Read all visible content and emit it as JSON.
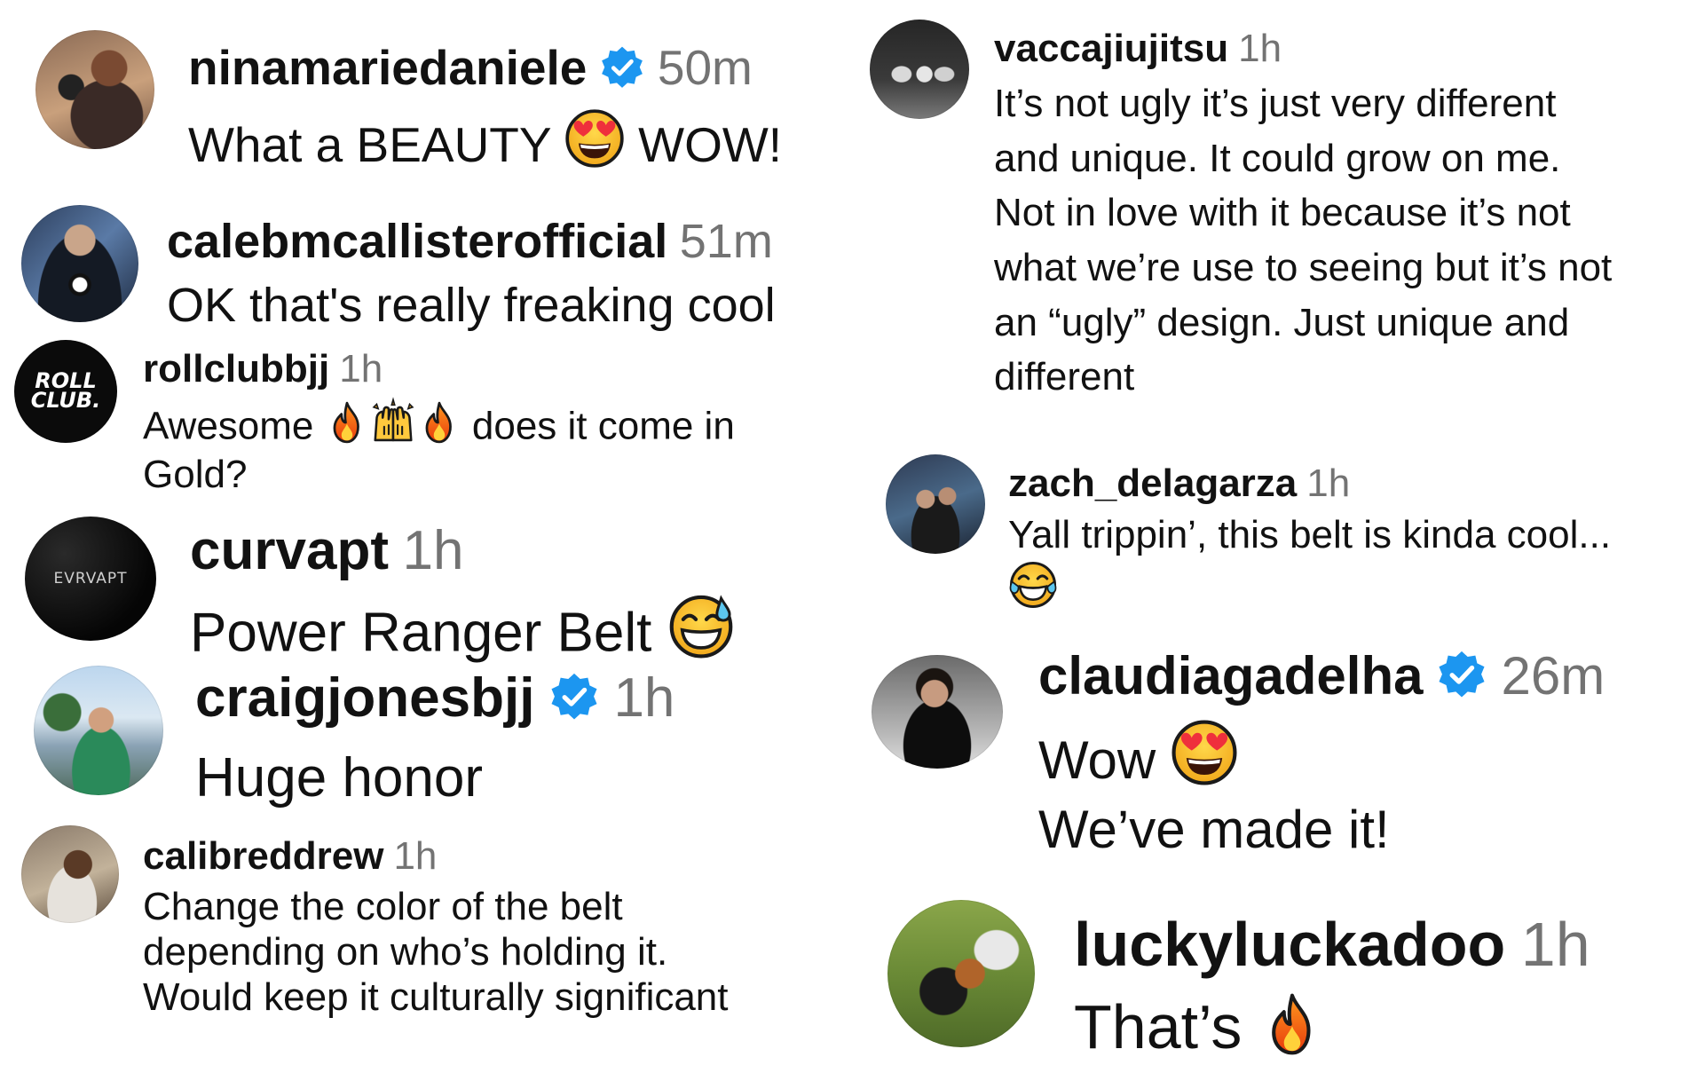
{
  "colors": {
    "username": "#121212",
    "timestamp": "#737373",
    "verified_badge": "#1c96f0",
    "text": "#111111"
  },
  "comments": [
    {
      "username": "ninamariedaniele",
      "verified": true,
      "time": "50m",
      "lines": [
        {
          "before": "What a BEAUTY",
          "emoji": "heart-eyes",
          "after": "WOW!"
        }
      ]
    },
    {
      "username": "calebmcallisterofficial",
      "verified": false,
      "time": "51m",
      "lines": [
        {
          "text": "OK that's really freaking cool"
        }
      ]
    },
    {
      "username": "rollclubbjj",
      "verified": false,
      "time": "1h",
      "avatar_text": [
        "ROLL",
        "CLUB."
      ],
      "lines": [
        {
          "before": "Awesome",
          "emoji": "fire, raised-hands, fire",
          "after": "does it come in"
        },
        {
          "text": "Gold?"
        }
      ]
    },
    {
      "username": "curvapt",
      "verified": false,
      "time": "1h",
      "avatar_text": "EVRVAPT",
      "lines": [
        {
          "before": "Power Ranger Belt",
          "emoji": "grinning-sweat"
        }
      ]
    },
    {
      "username": "craigjonesbjj",
      "verified": true,
      "time": "1h",
      "lines": [
        {
          "text": "Huge honor"
        }
      ]
    },
    {
      "username": "calibreddrew",
      "verified": false,
      "time": "1h",
      "lines": [
        {
          "text": "Change the color of the belt"
        },
        {
          "text": "depending on who’s holding it."
        },
        {
          "text": "Would keep it culturally significant"
        }
      ]
    },
    {
      "username": "vaccajiujitsu",
      "verified": false,
      "time": "1h",
      "lines": [
        {
          "text": "It’s not ugly it’s just very different"
        },
        {
          "text": "and unique. It could grow on me."
        },
        {
          "text": "Not in love with it because it’s not"
        },
        {
          "text": "what we’re use to seeing but it’s not"
        },
        {
          "text": "an “ugly” design. Just unique and"
        },
        {
          "text": "different"
        }
      ]
    },
    {
      "username": "zach_delagarza",
      "verified": false,
      "time": "1h",
      "lines": [
        {
          "text": "Yall trippin’, this belt is kinda cool..."
        },
        {
          "emoji": "joy"
        }
      ]
    },
    {
      "username": "claudiagadelha",
      "verified": true,
      "time": "26m",
      "lines": [
        {
          "before": "Wow",
          "emoji": "heart-eyes"
        },
        {
          "text": "We’ve made it!"
        }
      ]
    },
    {
      "username": "luckyluckadoo",
      "verified": false,
      "time": "1h",
      "lines": [
        {
          "before": "That’s",
          "emoji": "fire"
        }
      ]
    }
  ]
}
